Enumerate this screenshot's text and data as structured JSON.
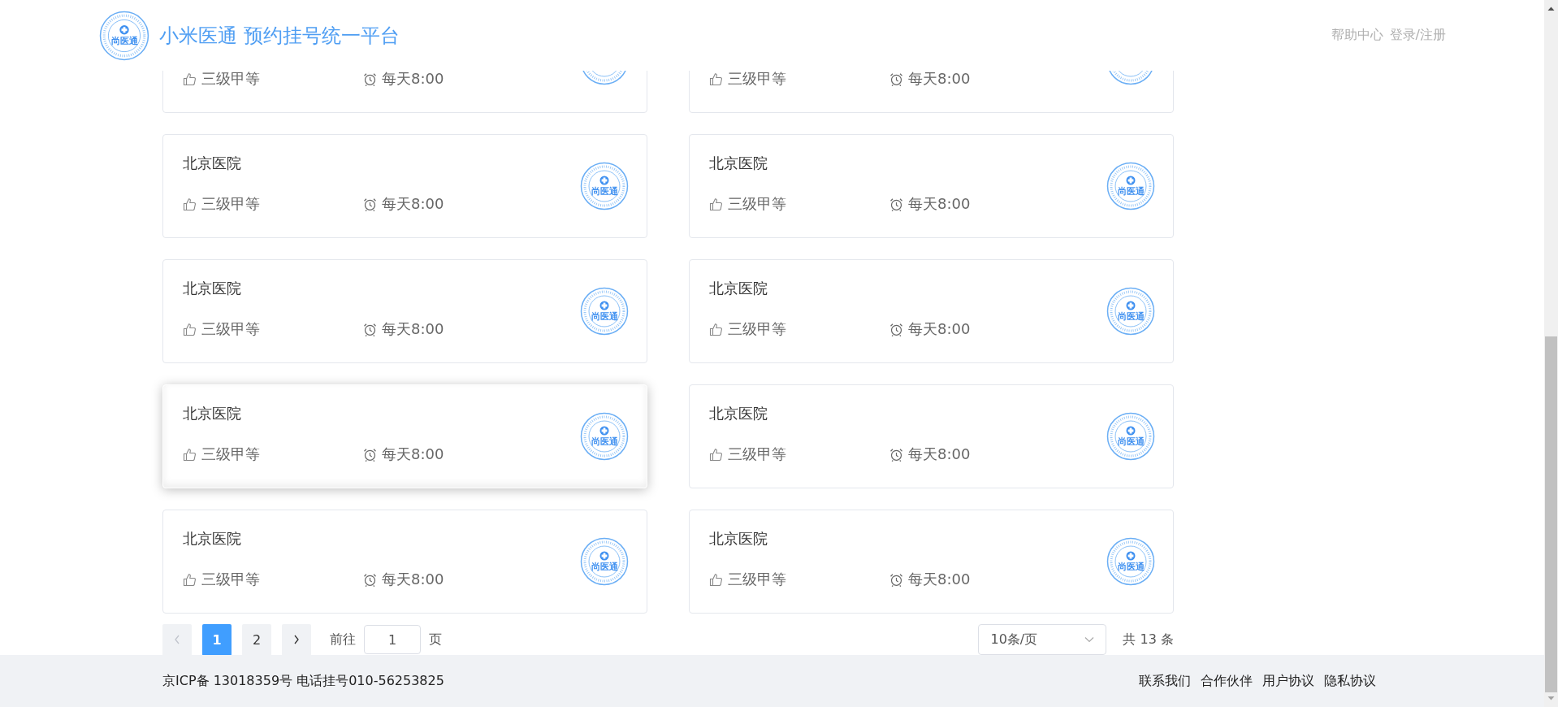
{
  "header": {
    "badge": "尚医通",
    "title": "小米医通 预约挂号统一平台",
    "links": [
      "帮助中心",
      "登录/注册"
    ]
  },
  "hospitals": [
    {
      "grade": "三级甲等",
      "time": "每天8:00",
      "hovered": false
    },
    {
      "grade": "三级甲等",
      "time": "每天8:00",
      "hovered": false
    },
    {
      "name": "北京医院",
      "badge": "尚医通",
      "grade": "三级甲等",
      "time": "每天8:00",
      "hovered": false
    },
    {
      "name": "北京医院",
      "badge": "尚医通",
      "grade": "三级甲等",
      "time": "每天8:00",
      "hovered": false
    },
    {
      "name": "北京医院",
      "badge": "尚医通",
      "grade": "三级甲等",
      "time": "每天8:00",
      "hovered": false
    },
    {
      "name": "北京医院",
      "badge": "尚医通",
      "grade": "三级甲等",
      "time": "每天8:00",
      "hovered": false
    },
    {
      "name": "北京医院",
      "badge": "尚医通",
      "grade": "三级甲等",
      "time": "每天8:00",
      "hovered": true
    },
    {
      "name": "北京医院",
      "badge": "尚医通",
      "grade": "三级甲等",
      "time": "每天8:00",
      "hovered": false
    },
    {
      "name": "北京医院",
      "badge": "尚医通",
      "grade": "三级甲等",
      "time": "每天8:00",
      "hovered": false
    },
    {
      "name": "北京医院",
      "badge": "尚医通",
      "grade": "三级甲等",
      "time": "每天8:00",
      "hovered": false
    }
  ],
  "pagination": {
    "prev": {
      "disabled": true
    },
    "pages": [
      {
        "label": "1",
        "selected": true
      },
      {
        "label": "2",
        "selected": false
      }
    ],
    "next": {
      "disabled": false
    },
    "goto_label": "前往",
    "goto_value": "1",
    "page_unit": "页",
    "page_size": "10条/页",
    "total": "共 13 条"
  },
  "footer": {
    "icp": "京ICP备 13018359号 电话挂号010-56253825",
    "links": [
      "联系我们",
      "合作伙伴",
      "用户协议",
      "隐私协议"
    ]
  }
}
